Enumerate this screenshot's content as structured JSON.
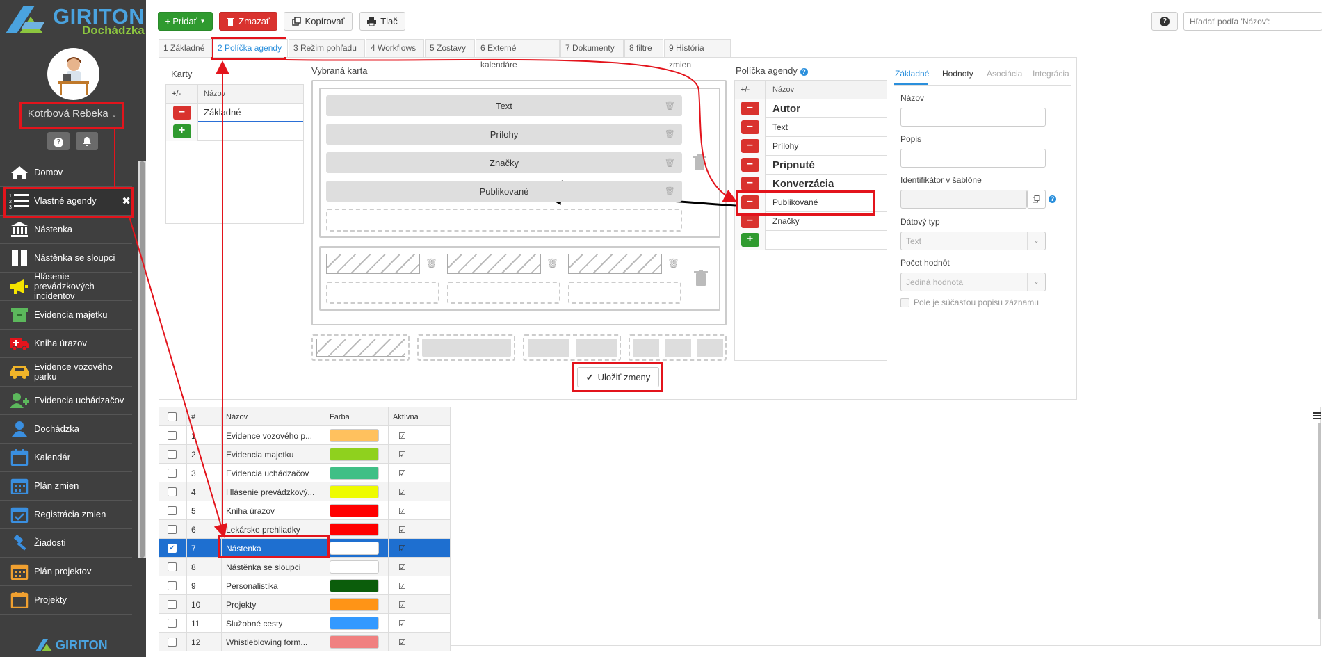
{
  "app": {
    "brand": "GIRITON",
    "module": "Dochádzka",
    "footer_brand": "GIRITON"
  },
  "user": {
    "name": "Kotrbová Rebeka"
  },
  "sidebar": {
    "items": [
      {
        "label": "Domov",
        "icon": "home-icon"
      },
      {
        "label": "Vlastné agendy",
        "icon": "list-icon",
        "active": true
      },
      {
        "label": "Nástenka",
        "icon": "bank-icon"
      },
      {
        "label": "Nástěnka se sloupci",
        "icon": "columns-icon"
      },
      {
        "label": "Hlásenie prevádzkových incidentov",
        "icon": "megaphone-icon"
      },
      {
        "label": "Evidencia majetku",
        "icon": "box-icon"
      },
      {
        "label": "Kniha úrazov",
        "icon": "ambulance-icon"
      },
      {
        "label": "Evidence vozového parku",
        "icon": "car-icon"
      },
      {
        "label": "Evidencia uchádzačov",
        "icon": "user-plus-icon"
      },
      {
        "label": "Dochádzka",
        "icon": "user-icon"
      },
      {
        "label": "Kalendár",
        "icon": "calendar-icon"
      },
      {
        "label": "Plán zmien",
        "icon": "calendar-grid-icon"
      },
      {
        "label": "Registrácia zmien",
        "icon": "calendar-check-icon"
      },
      {
        "label": "Žiadosti",
        "icon": "gavel-icon"
      },
      {
        "label": "Plán projektov",
        "icon": "calendar-grid-icon"
      },
      {
        "label": "Projekty",
        "icon": "calendar-icon"
      }
    ]
  },
  "toolbar": {
    "add": "Pridať",
    "delete": "Zmazať",
    "copy": "Kopírovať",
    "print": "Tlač",
    "help": "?",
    "search_placeholder": "Hľadať podľa 'Názov':"
  },
  "tabs": [
    "1 Základné",
    "2 Políčka agendy",
    "3 Režim pohľadu",
    "4 Workflows",
    "5 Zostavy",
    "6 Externé kalendáre",
    "7 Dokumenty",
    "8 filtre",
    "9 História zmien"
  ],
  "cards": {
    "title": "Karty",
    "col_pm": "+/-",
    "col_name": "Názov",
    "rows": [
      "Základné"
    ]
  },
  "selected_card": {
    "title": "Vybraná karta",
    "fields": [
      "Text",
      "Prílohy",
      "Značky",
      "Publikované"
    ]
  },
  "save_button": "Uložiť zmeny",
  "agenda_fields": {
    "title": "Políčka agendy",
    "col_pm": "+/-",
    "col_name": "Názov",
    "rows": [
      {
        "name": "Autor",
        "bold": true
      },
      {
        "name": "Text",
        "bold": false
      },
      {
        "name": "Prílohy",
        "bold": false
      },
      {
        "name": "Pripnuté",
        "bold": true
      },
      {
        "name": "Konverzácia",
        "bold": true
      },
      {
        "name": "Publikované",
        "bold": false
      },
      {
        "name": "Značky",
        "bold": false
      }
    ]
  },
  "detail": {
    "tabs": [
      "Základné",
      "Hodnoty",
      "Asociácia",
      "Integrácia"
    ],
    "name_label": "Názov",
    "desc_label": "Popis",
    "template_label": "Identifikátor v šablóne",
    "datatype_label": "Dátový typ",
    "datatype_value": "Text",
    "count_label": "Počet hodnôt",
    "count_value": "Jediná hodnota",
    "checkbox_label": "Pole je súčasťou popisu záznamu"
  },
  "table": {
    "headers": [
      "#",
      "Názov",
      "Farba",
      "Aktívna"
    ],
    "rows": [
      {
        "n": "1",
        "name": "Evidence vozového p...",
        "color": "#ffc15e",
        "checked": false
      },
      {
        "n": "2",
        "name": "Evidencia majetku",
        "color": "#8fd11e",
        "checked": false
      },
      {
        "n": "3",
        "name": "Evidencia uchádzačov",
        "color": "#3fbf86",
        "checked": false
      },
      {
        "n": "4",
        "name": "Hlásenie prevádzkový...",
        "color": "#eefb00",
        "checked": false
      },
      {
        "n": "5",
        "name": "Kniha úrazov",
        "color": "#ff0000",
        "checked": false
      },
      {
        "n": "6",
        "name": "Lekárske prehliadky",
        "color": "#ff0000",
        "checked": false
      },
      {
        "n": "7",
        "name": "Nástenka",
        "color": "#ffffff",
        "checked": true
      },
      {
        "n": "8",
        "name": "Nástěnka se sloupci",
        "color": "#ffffff",
        "checked": false
      },
      {
        "n": "9",
        "name": "Personalistika",
        "color": "#0b5d0b",
        "checked": false
      },
      {
        "n": "10",
        "name": "Projekty",
        "color": "#ff9416",
        "checked": false
      },
      {
        "n": "11",
        "name": "Služobné cesty",
        "color": "#3399ff",
        "checked": false
      },
      {
        "n": "12",
        "name": "Whistleblowing form...",
        "color": "#f08080",
        "checked": false
      }
    ]
  }
}
